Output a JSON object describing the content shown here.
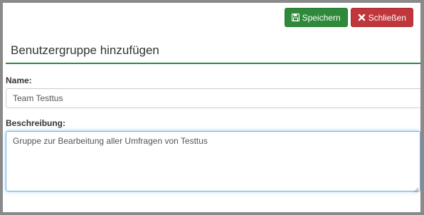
{
  "toolbar": {
    "save_label": "Speichern",
    "save_icon": "floppy-disk-icon",
    "close_label": "Schließen",
    "close_icon": "close-x-icon"
  },
  "form": {
    "title": "Benutzergruppe hinzufügen",
    "name_label": "Name:",
    "name_value": "Team Testtus",
    "description_label": "Beschreibung:",
    "description_value": "Gruppe zur Bearbeitung aller Umfragen von Testtus"
  },
  "colors": {
    "save_button": "#2e8a3a",
    "close_button": "#c0363a",
    "title_rule": "#2e8a3a",
    "focus_border": "#66afe9"
  }
}
